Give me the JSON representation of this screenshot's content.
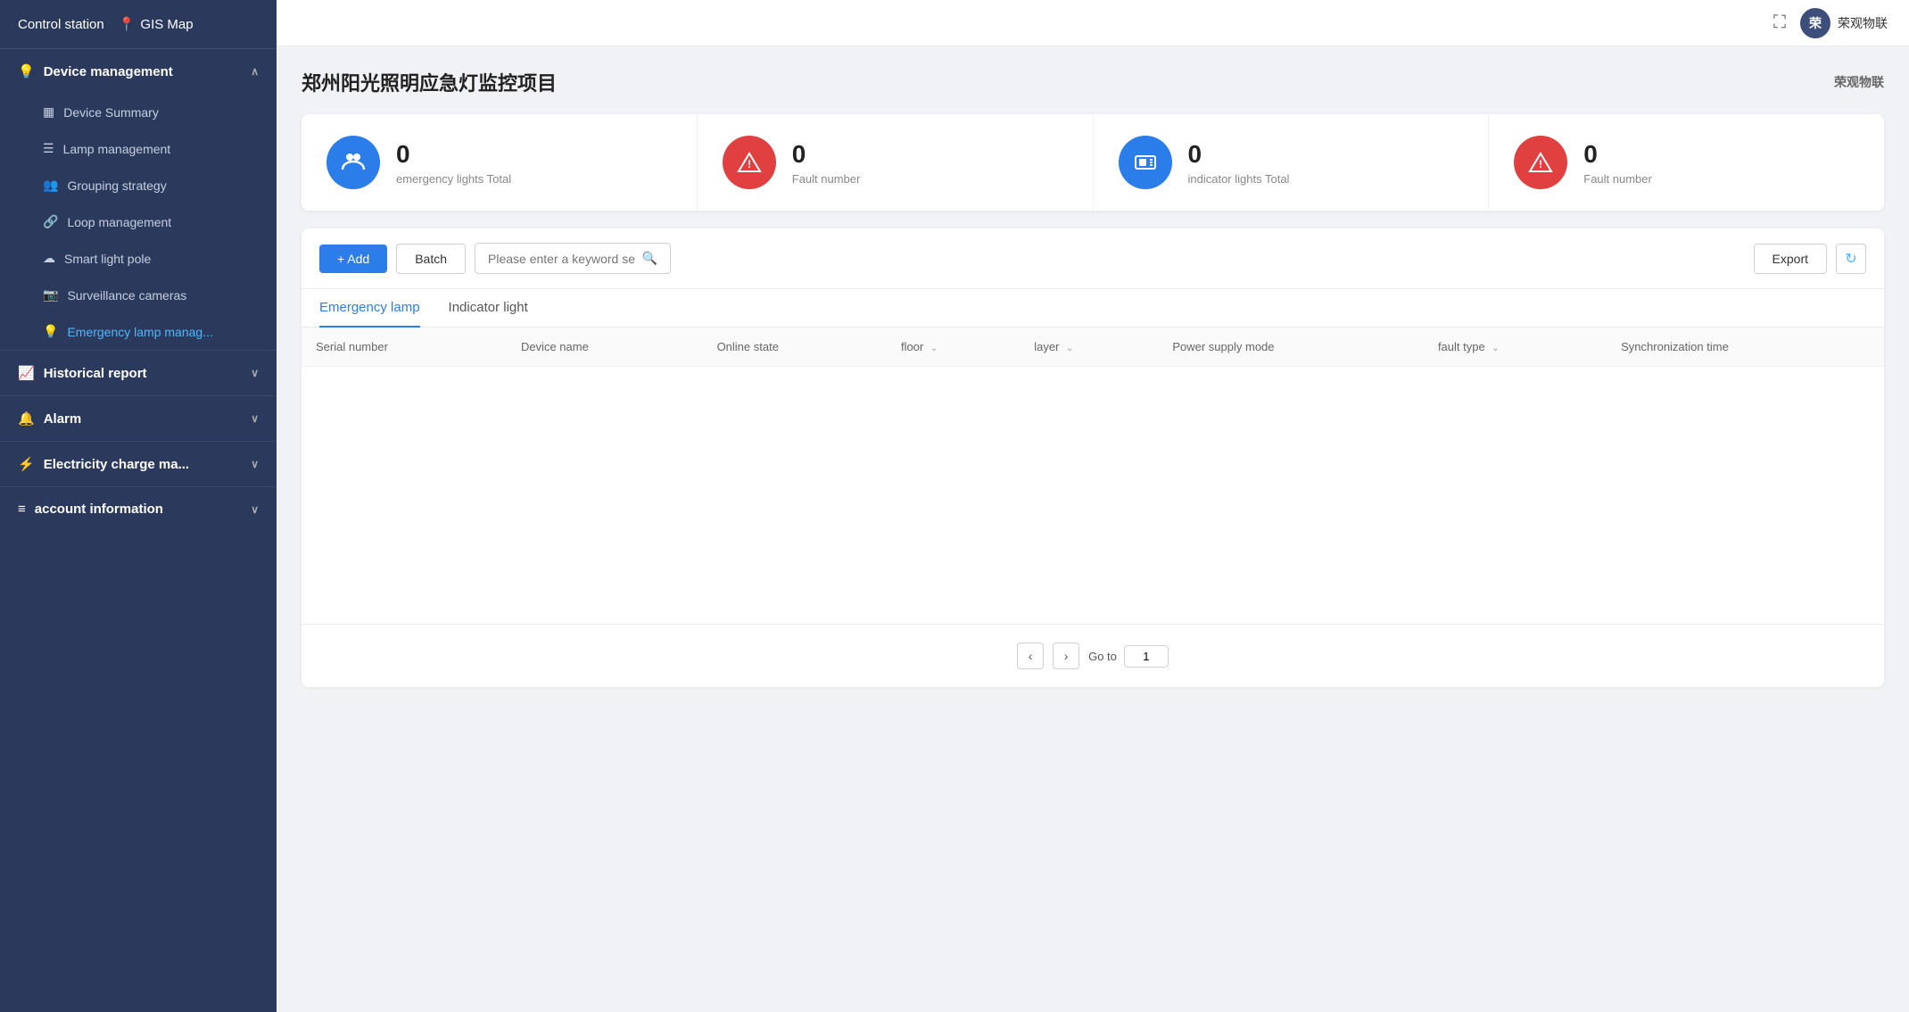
{
  "header": {
    "nav": [
      {
        "id": "control-station",
        "label": "Control station"
      },
      {
        "id": "gis-map",
        "label": "GIS Map",
        "icon": "📍"
      }
    ],
    "expand_icon": "⛶",
    "user": {
      "avatar_text": "荣",
      "username": "荣观物联"
    }
  },
  "sidebar": {
    "device_management": {
      "label": "Device management",
      "icon": "💡",
      "expanded": true,
      "items": [
        {
          "id": "device-summary",
          "label": "Device Summary",
          "icon": "📊"
        },
        {
          "id": "lamp-management",
          "label": "Lamp management",
          "icon": "☰"
        },
        {
          "id": "grouping-strategy",
          "label": "Grouping strategy",
          "icon": "👥"
        },
        {
          "id": "loop-management",
          "label": "Loop management",
          "icon": "🔗"
        },
        {
          "id": "smart-light-pole",
          "label": "Smart light pole",
          "icon": "☁"
        },
        {
          "id": "surveillance-cameras",
          "label": "Surveillance cameras",
          "icon": "📷"
        },
        {
          "id": "emergency-lamp",
          "label": "Emergency lamp manag...",
          "icon": "💡",
          "active": true
        }
      ]
    },
    "historical_report": {
      "label": "Historical report",
      "icon": "📈",
      "expanded": false
    },
    "alarm": {
      "label": "Alarm",
      "icon": "🔔",
      "expanded": false
    },
    "electricity_charge": {
      "label": "Electricity charge ma...",
      "icon": "⚡",
      "expanded": false
    },
    "account_information": {
      "label": "account information",
      "icon": "≡",
      "expanded": false
    }
  },
  "page": {
    "title": "郑州阳光照明应急灯监控项目",
    "subtitle": "荣观物联"
  },
  "summary": {
    "cards": [
      {
        "id": "emergency-total",
        "count": "0",
        "label": "emergency lights Total",
        "icon_type": "blue",
        "icon": "👥"
      },
      {
        "id": "emergency-fault",
        "count": "0",
        "label": "Fault number",
        "icon_type": "red",
        "icon": "⚠"
      },
      {
        "id": "indicator-total",
        "count": "0",
        "label": "indicator lights Total",
        "icon_type": "blue",
        "icon": "🖥"
      },
      {
        "id": "indicator-fault",
        "count": "0",
        "label": "Fault number",
        "icon_type": "red",
        "icon": "⚠"
      }
    ]
  },
  "toolbar": {
    "add_label": "+ Add",
    "batch_label": "Batch",
    "search_placeholder": "Please enter a keyword se",
    "export_label": "Export"
  },
  "tabs": [
    {
      "id": "emergency-lamp",
      "label": "Emergency lamp",
      "active": true
    },
    {
      "id": "indicator-light",
      "label": "Indicator light",
      "active": false
    }
  ],
  "table": {
    "columns": [
      {
        "id": "serial-number",
        "label": "Serial number",
        "sortable": false
      },
      {
        "id": "device-name",
        "label": "Device name",
        "sortable": false
      },
      {
        "id": "online-state",
        "label": "Online state",
        "sortable": false
      },
      {
        "id": "floor",
        "label": "floor",
        "sortable": true
      },
      {
        "id": "layer",
        "label": "layer",
        "sortable": true
      },
      {
        "id": "power-supply-mode",
        "label": "Power supply mode",
        "sortable": false
      },
      {
        "id": "fault-type",
        "label": "fault type",
        "sortable": true
      },
      {
        "id": "synchronization-time",
        "label": "Synchronization time",
        "sortable": false
      }
    ],
    "rows": []
  },
  "pagination": {
    "prev_icon": "‹",
    "next_icon": "›",
    "goto_label": "Go to",
    "current_page": "1"
  }
}
